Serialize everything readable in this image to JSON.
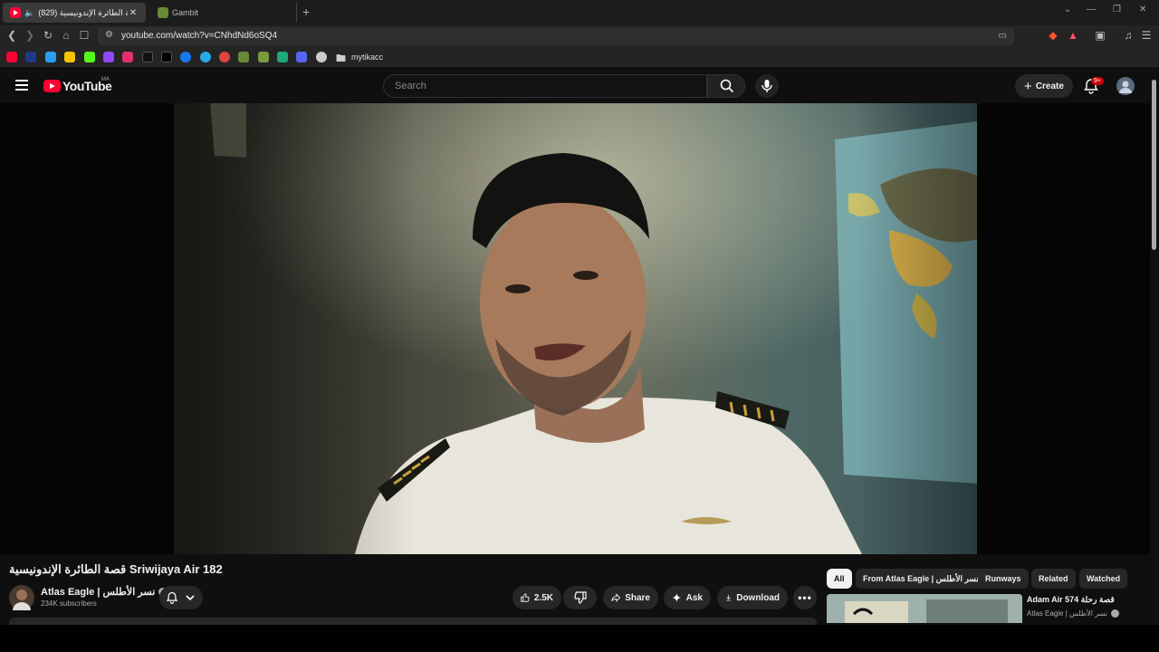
{
  "browser": {
    "tabs": [
      {
        "title": "(829) قصة الطائرة الإندونيسية",
        "active": true
      },
      {
        "title": "Gambit",
        "active": false
      }
    ],
    "url": "youtube.com/watch?v=CNhdNd6oSQ4",
    "bookmark_folder": "mytikacc"
  },
  "youtube": {
    "logo_text": "YouTube",
    "region": "MA",
    "search_placeholder": "Search",
    "create_label": "Create",
    "notification_badge": "9+"
  },
  "video": {
    "title": "قصة الطائرة الإندونيسية Sriwijaya Air 182",
    "channel_name": "Atlas Eagle | نسر الأطلس",
    "subscribers": "234K subscribers",
    "likes": "2.5K",
    "share_label": "Share",
    "ask_label": "Ask",
    "download_label": "Download"
  },
  "chips": [
    "All",
    "From Atlas Eagle | نسر الأطلس",
    "Runways",
    "Related",
    "Watched"
  ],
  "recommendation": {
    "title": "Adam Air 574 قصة رحلة",
    "channel": "Atlas Eagle | نسر الأطلس"
  },
  "colors": {
    "background": "#0f0f0f",
    "surface": "#272727",
    "youtube_red": "#ff0033",
    "badge_red": "#cc0000"
  }
}
